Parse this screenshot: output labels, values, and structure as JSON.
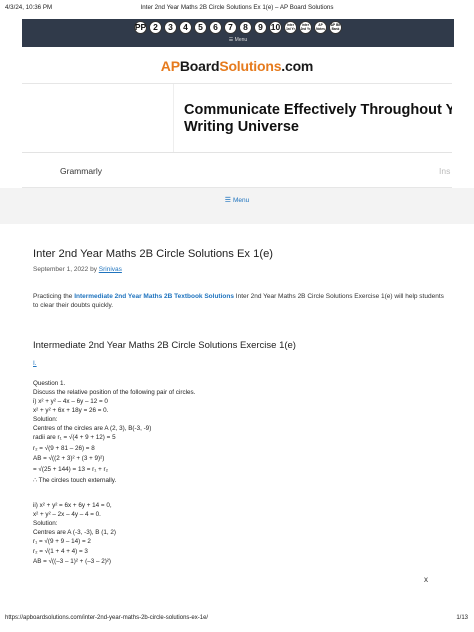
{
  "print_header": {
    "datetime": "4/3/24, 10:36 PM",
    "title": "Inter 2nd Year Maths 2B Circle Solutions Ex 1(e) – AP Board Solutions"
  },
  "top_nav": {
    "items": [
      "PP",
      "2",
      "3",
      "4",
      "5",
      "6",
      "7",
      "8",
      "9",
      "10",
      "Inter 1st Yr",
      "Inter 2nd Yr",
      "AP Notes",
      "AP Bit Bank"
    ],
    "menu_label": "☰ Menu"
  },
  "logo": {
    "part1": "AP",
    "part2": "Board",
    "part3": "Solutions",
    "part4": ".com"
  },
  "ad": {
    "headline_line1": "Communicate Effectively Throughout Your",
    "headline_line2": "Writing Universe",
    "brand": "Grammarly",
    "cta": "Ins"
  },
  "menu_button": {
    "icon": "☰",
    "label": "Menu"
  },
  "post": {
    "title": "Inter 2nd Year Maths 2B Circle Solutions Ex 1(e)",
    "date": "September 1, 2022 by ",
    "author": "Srinivas",
    "intro_prefix": "Practicing the ",
    "intro_link": "Intermediate 2nd Year Maths 2B Textbook Solutions",
    "intro_suffix": " Inter 2nd Year Maths 2B Circle Solutions Exercise 1(e) will help students to clear their doubts quickly.",
    "section_heading": "Intermediate 2nd Year Maths 2B Circle Solutions Exercise 1(e)",
    "section_link": "I."
  },
  "solution_lines": [
    "Question 1.",
    "Discuss the relative position of the following pair of circles.",
    "i) x² + y² – 4x – 6y – 12 = 0",
    "x² + y² + 6x + 18y = 26 = 0.",
    "Solution:",
    "Centres of the circles are A (2, 3), B(-3, -9)",
    "radii are r₁ = √(4 + 9 + 12) = 5",
    "r₂ = √(9 + 81 – 26) = 8",
    "AB = √((2 + 3)² + (3 + 9)²)",
    "= √(25 + 144) = 13 = r₁ + r₂",
    "∴ The circles touch externally.",
    "",
    "ii) x² + y² = 6x + 6y + 14 = 0,",
    "x² + y² – 2x – 4y – 4 = 0.",
    "Solution:",
    "Centres are A (-3, -3), B (1, 2)",
    "r₁ = √(9 + 9 – 14) = 2",
    "r₂ = √(1 + 4 + 4) = 3",
    "AB = √((–3 – 1)² + (–3 – 2)²)"
  ],
  "close_label": "x",
  "print_footer": {
    "url": "https://apboardsolutions.com/inter-2nd-year-maths-2b-circle-solutions-ex-1e/",
    "page": "1/13"
  }
}
